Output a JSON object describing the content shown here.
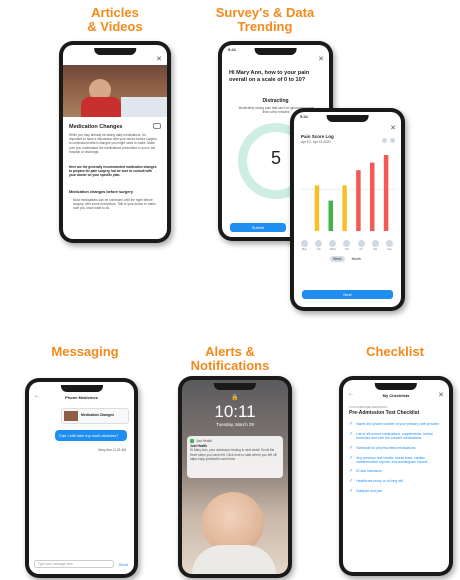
{
  "captions": {
    "articles": "Articles\n& Videos",
    "survey": "Survey's & Data\nTrending",
    "messaging": "Messaging",
    "alerts": "Alerts &\nNotifications",
    "checklist": "Checklist"
  },
  "articles": {
    "title": "Medication Changes",
    "intro": "While you may already be taking daily medications, it's important to have a discussion with your doctor before surgery to understand which changes you might need to make. Make sure you understand the medications prescribed to you in the hospital or discharge.",
    "bold_text": "Here are the generally recommended medication changes to prepare for pain surgery, but be sure to consult with your doctor on your specific plan.",
    "subhead": "Medication changes before surgery",
    "bullet": "Most medications can be continued until the night before surgery, with some exceptions. Talk to your doctor to make sure you know what to do."
  },
  "survey": {
    "question": "Hi Mary Ann, how to your pain overall on a scale of 0 to 10?",
    "level_label": "Distracting",
    "level_desc": "Moderately strong pain that can't be ignored for more than a few minutes",
    "value": "5",
    "submit_label": "Submit"
  },
  "pain_log": {
    "title": "Pain Score Log",
    "date_range": "Apr 10 - Apr 16 2020",
    "toggle_week": "Week",
    "toggle_month": "Month",
    "next_label": "Next",
    "day_labels": [
      "Mon",
      "Tue",
      "Wed",
      "Thu",
      "Fri",
      "Sat",
      "Sun"
    ],
    "bar_colors": [
      "#f6c026",
      "#3fb54a",
      "#f6c026",
      "#f25a56",
      "#f25a56",
      "#f25a56"
    ]
  },
  "chart_data": {
    "type": "bar",
    "title": "Pain Score Log",
    "categories": [
      "1",
      "2",
      "3",
      "4",
      "5",
      "6"
    ],
    "values": [
      6,
      4,
      6,
      8,
      9,
      10
    ],
    "ylim": [
      0,
      10
    ]
  },
  "messaging": {
    "header": "Phone Medicines",
    "article_label": "Medication Changes",
    "bubble": "Can I still take my multi-vitamins?",
    "sent_time": "Mary Ann 11:21 AM",
    "input_placeholder": "Type your message here",
    "send_label": "Send"
  },
  "alerts": {
    "time": "10:11",
    "date": "Tuesday, March 29",
    "app": "Just Health",
    "notif_title": "Just Health",
    "notif_body": "Hi Mary Ann, your admission testing is next week! Scroll the three steps you have left. Click here to start where you left off: https://app.justhealth.com/home"
  },
  "checklist": {
    "header": "My Checklists",
    "small_label": "5 DAYS BEFORE ADMISSION",
    "title": "Pre-Admission Test Checklist",
    "items": [
      "Name and phone number of your primary care provider",
      "List of all current medications, supplements, herbal remedies and over the counter medications",
      "Schedule for all prescribed medications",
      "Any previous test results: stress tests, cardiac catheterization reports, echocardiogram reports",
      "ID and insurance",
      "Healthcare proxy or a living will",
      "Notepad and pen"
    ]
  }
}
